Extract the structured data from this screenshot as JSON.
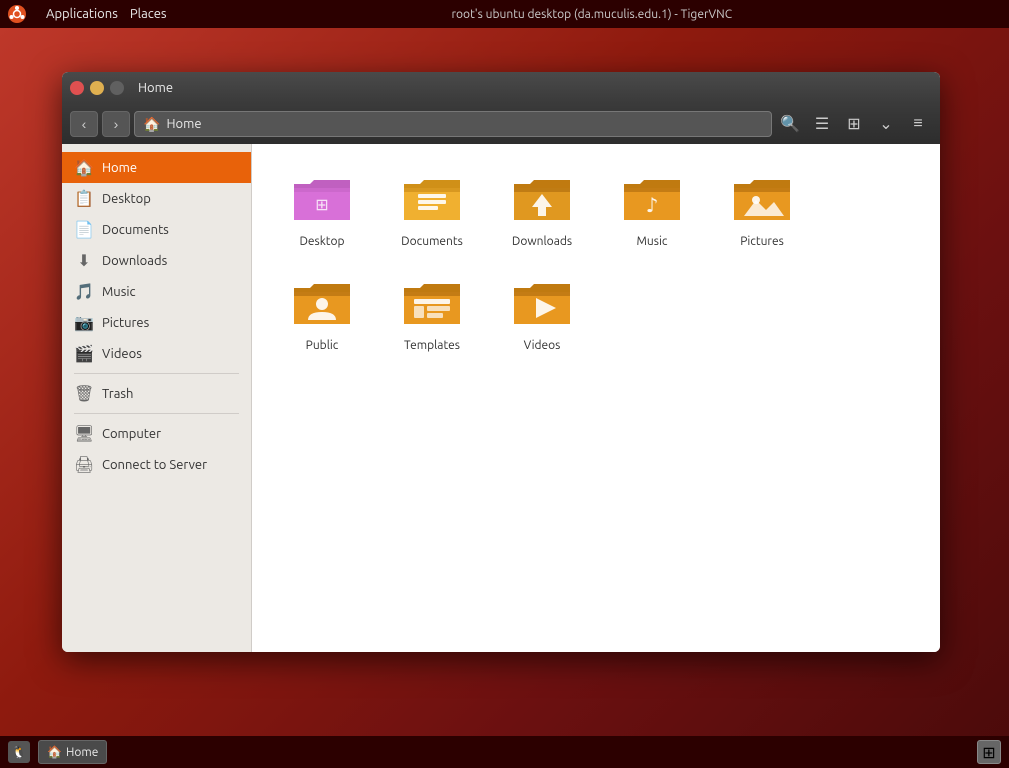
{
  "topbar": {
    "title": "root's ubuntu desktop (da.muculis.edu.1) - TigerVNC",
    "menu": [
      "Applications",
      "Places"
    ]
  },
  "window": {
    "title": "Home",
    "location": "Home"
  },
  "sidebar": {
    "items": [
      {
        "id": "home",
        "label": "Home",
        "icon": "🏠",
        "active": true
      },
      {
        "id": "desktop",
        "label": "Desktop",
        "icon": "📋"
      },
      {
        "id": "documents",
        "label": "Documents",
        "icon": "📄"
      },
      {
        "id": "downloads",
        "label": "Downloads",
        "icon": "⬇"
      },
      {
        "id": "music",
        "label": "Music",
        "icon": "🎵"
      },
      {
        "id": "pictures",
        "label": "Pictures",
        "icon": "📷"
      },
      {
        "id": "videos",
        "label": "Videos",
        "icon": "🎬"
      },
      {
        "id": "trash",
        "label": "Trash",
        "icon": "🗑"
      },
      {
        "id": "computer",
        "label": "Computer",
        "icon": "🖥"
      },
      {
        "id": "connect",
        "label": "Connect to Server",
        "icon": "🖨"
      }
    ]
  },
  "files": [
    {
      "name": "Desktop",
      "type": "desktop"
    },
    {
      "name": "Documents",
      "type": "documents"
    },
    {
      "name": "Downloads",
      "type": "downloads"
    },
    {
      "name": "Music",
      "type": "music"
    },
    {
      "name": "Pictures",
      "type": "pictures"
    },
    {
      "name": "Public",
      "type": "public"
    },
    {
      "name": "Templates",
      "type": "templates"
    },
    {
      "name": "Videos",
      "type": "videos"
    }
  ],
  "toolbar": {
    "back_label": "‹",
    "forward_label": "›",
    "home_label": "🏠",
    "location": "Home"
  },
  "taskbar": {
    "home_label": "Home"
  }
}
